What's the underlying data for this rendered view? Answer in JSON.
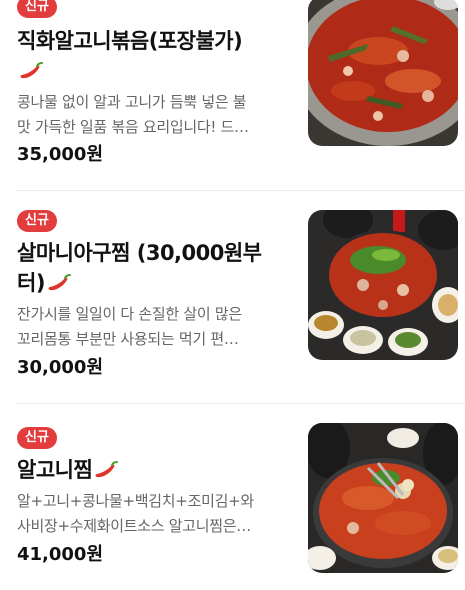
{
  "menu": {
    "items": [
      {
        "badge": "신규",
        "title_line1": "직화알고니볶음(포장불가)",
        "title_line2": "",
        "desc_line1": "콩나물 없이 알과 고니가 듬뿍 넣은 불",
        "desc_line2": "맛 가득한 일품 볶음 요리입니다! 드…",
        "price": "35,000원",
        "spicy_icon": "chili-pepper-icon"
      },
      {
        "badge": "신규",
        "title_line1": "살마니아구찜 (30,000원부",
        "title_line2": "터)",
        "desc_line1": "잔가시를 일일이 다 손질한 살이 많은",
        "desc_line2": "꼬리몸통 부분만 사용되는 먹기 편…",
        "price": "30,000원",
        "spicy_icon": "chili-pepper-icon"
      },
      {
        "badge": "신규",
        "title_line1": "알고니찜",
        "title_line2": "",
        "desc_line1": "알+고니+콩나물+백김치+조미김+와",
        "desc_line2": "사비장+수제화이트소스 알고니찜은…",
        "price": "41,000원",
        "spicy_icon": "chili-pepper-icon"
      }
    ]
  },
  "colors": {
    "badge": "#e23c3c",
    "pepper": "#e0342a",
    "divider": "#ececec"
  }
}
